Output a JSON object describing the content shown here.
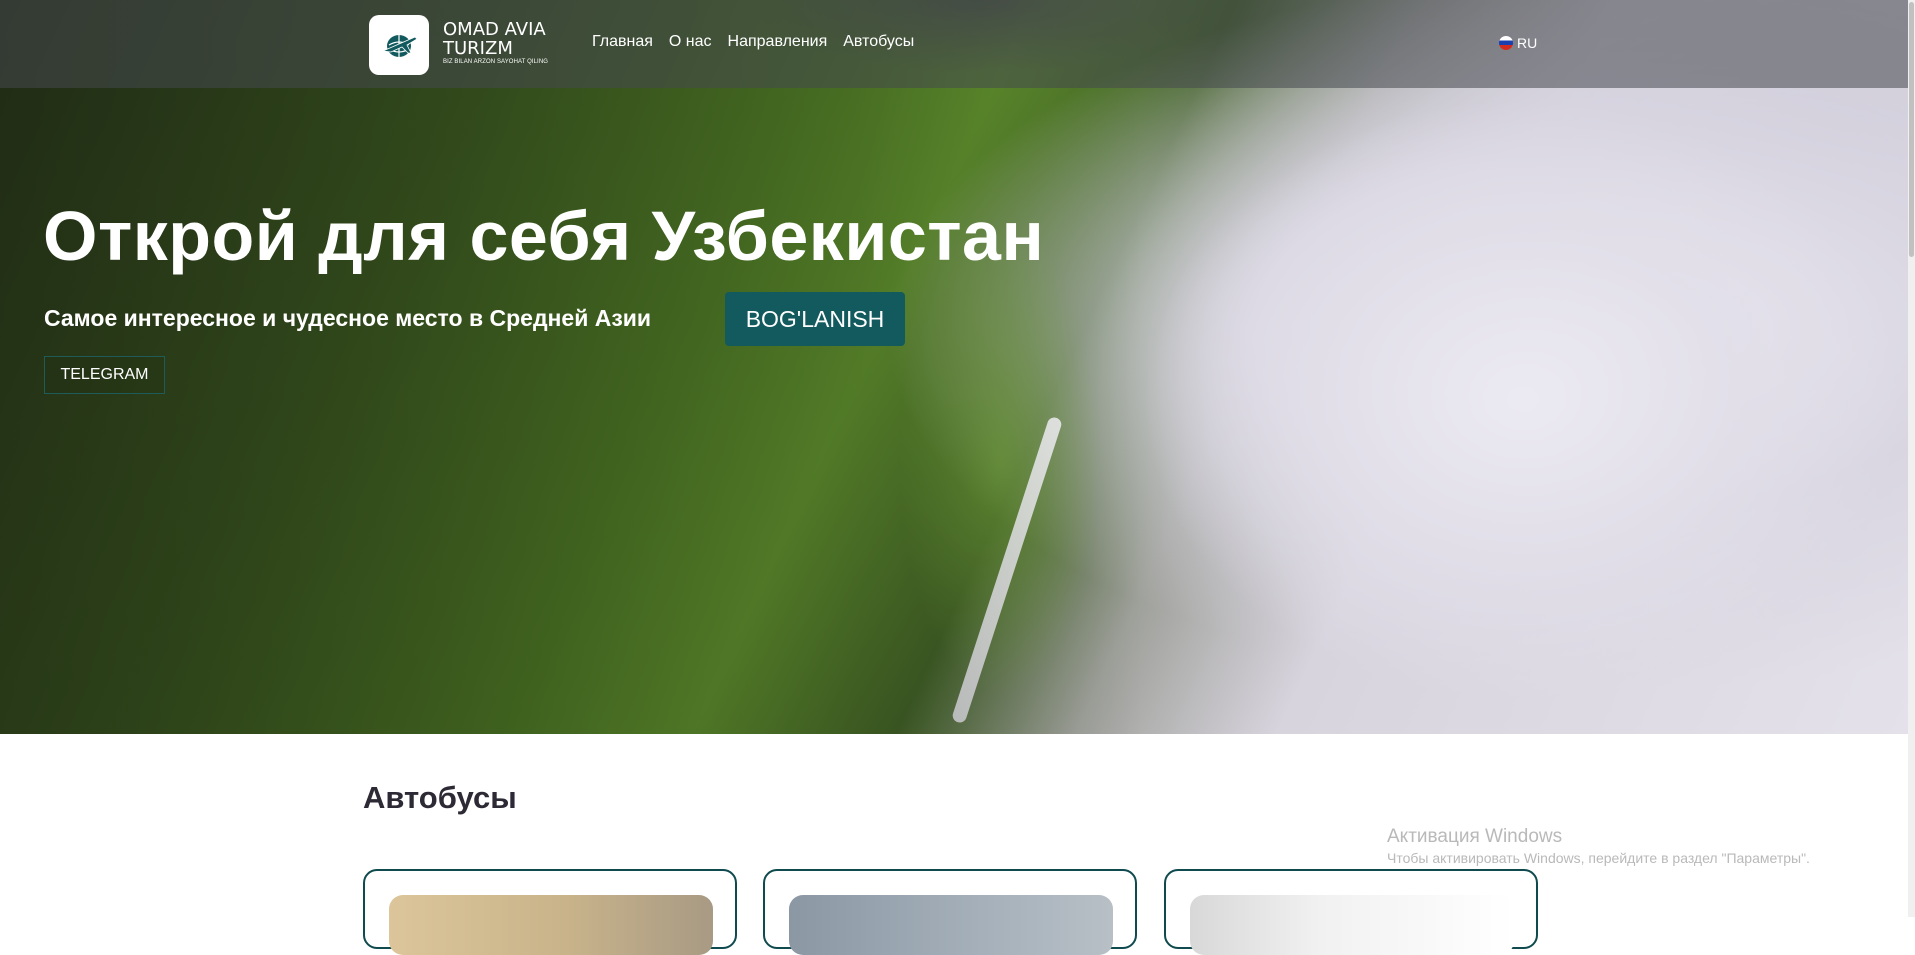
{
  "header": {
    "brand_title": "OMAD AVIA TURIZM",
    "brand_tagline": "BIZ BILAN ARZON SAYOHAT QILING",
    "logo_icon": "airplane-globe-icon",
    "nav": [
      {
        "label": "Главная"
      },
      {
        "label": "О нас"
      },
      {
        "label": "Направления"
      },
      {
        "label": "Автобусы"
      }
    ],
    "language": {
      "label": "RU",
      "flag_icon": "russia-flag-icon"
    }
  },
  "hero": {
    "title": "Открой для себя Узбекистан",
    "subtitle": "Самое интересное и чудесное место в Средней Азии",
    "booking_button": "BOG'LANISH",
    "telegram_button": "TELEGRAM"
  },
  "buses_section": {
    "title": "Автобусы",
    "cards": [
      {},
      {},
      {}
    ]
  },
  "windows_watermark": {
    "title": "Активация Windows",
    "text": "Чтобы активировать Windows, перейдите в раздел \"Параметры\"."
  },
  "colors": {
    "accent": "#125a5e",
    "card_border": "#0f4a4e"
  }
}
